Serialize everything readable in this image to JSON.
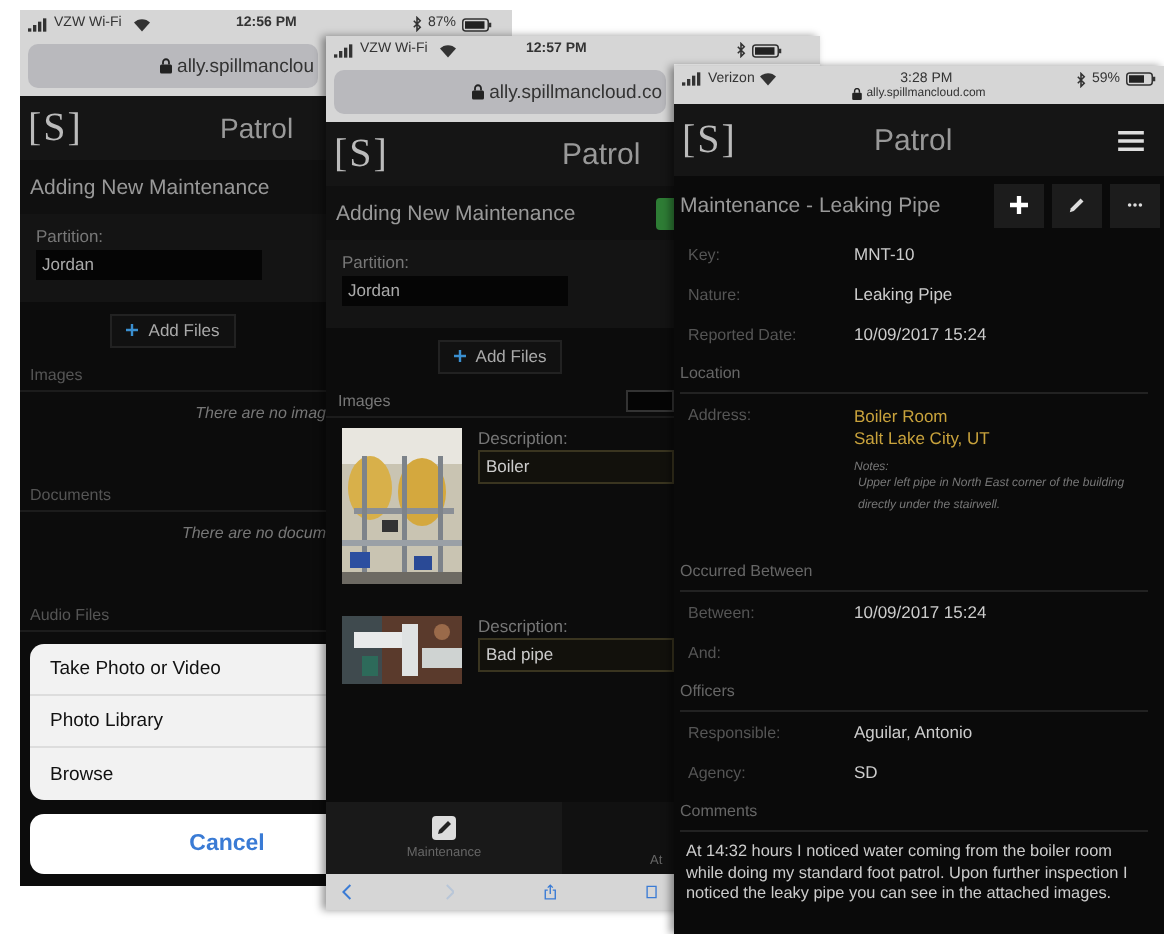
{
  "phone_1": {
    "status": {
      "carrier": "VZW Wi-Fi",
      "time": "12:56 PM",
      "battery": "87%"
    },
    "url": "ally.spillmanclou",
    "logo": "[S]",
    "app_title": "Patrol",
    "form_title": "Adding New Maintenance",
    "partition": {
      "label": "Partition:",
      "value": "Jordan"
    },
    "add_files": "Add Files",
    "sections": [
      {
        "title": "Images",
        "empty": "There are no imag"
      },
      {
        "title": "Documents",
        "empty": "There are no docum"
      },
      {
        "title": "Audio Files"
      }
    ],
    "action_sheet": {
      "options": [
        "Take Photo or Video",
        "Photo Library",
        "Browse"
      ],
      "cancel": "Cancel"
    }
  },
  "phone_2": {
    "status": {
      "carrier": "VZW Wi-Fi",
      "time": "12:57 PM"
    },
    "url": "ally.spillmancloud.co",
    "logo": "[S]",
    "app_title": "Patrol",
    "form_title": "Adding New Maintenance",
    "partition": {
      "label": "Partition:",
      "value": "Jordan"
    },
    "add_files": "Add Files",
    "images_title": "Images",
    "images": [
      {
        "kind": "picture",
        "label": "Description:",
        "value": "Boiler"
      },
      {
        "kind": "picture",
        "label": "Description:",
        "value": "Bad pipe"
      }
    ],
    "tabs": [
      "Maintenance",
      "At"
    ]
  },
  "phone_3": {
    "status": {
      "carrier": "Verizon",
      "time": "3:28 PM",
      "battery": "59%"
    },
    "url": "ally.spillmancloud.com",
    "logo": "[S]",
    "app_title": "Patrol",
    "title": "Maintenance - Leaking Pipe",
    "details": [
      {
        "kind": "field",
        "label": "Key:",
        "value": "MNT-10"
      },
      {
        "kind": "field",
        "label": "Nature:",
        "value": "Leaking Pipe"
      },
      {
        "kind": "field",
        "label": "Reported Date:",
        "value": "10/09/2017 15:24"
      },
      {
        "kind": "section",
        "title": "Location"
      },
      {
        "kind": "address",
        "label": "Address:",
        "lines": [
          "Boiler Room",
          "Salt Lake City, UT"
        ],
        "notes_label": "Notes:",
        "notes": "Upper left pipe in North East corner of the building directly under the stairwell."
      },
      {
        "kind": "section",
        "title": "Occurred Between"
      },
      {
        "kind": "field",
        "label": "Between:",
        "value": "10/09/2017 15:24"
      },
      {
        "kind": "field",
        "label": "And:"
      },
      {
        "kind": "section",
        "title": "Officers"
      },
      {
        "kind": "field",
        "label": "Responsible:",
        "value": "Aguilar, Antonio"
      },
      {
        "kind": "field",
        "label": "Agency:",
        "value": "SD"
      },
      {
        "kind": "section",
        "title": "Comments"
      },
      {
        "kind": "text",
        "text": "At 14:32 hours I noticed water coming from the boiler room while doing my standard foot patrol. Upon further inspection I noticed the leaky pipe you can see in the attached images."
      }
    ]
  }
}
